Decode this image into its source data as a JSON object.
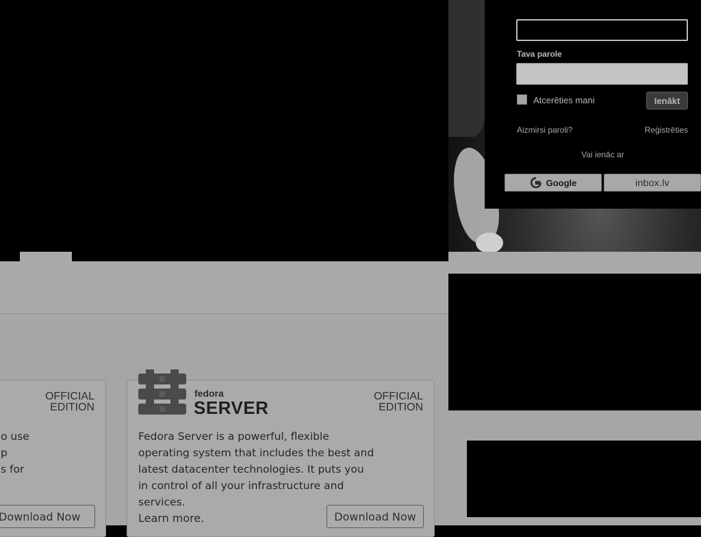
{
  "login": {
    "username_value": "",
    "password_label": "Tava parole",
    "password_value": "",
    "remember_label": "Atcerēties mani",
    "remember_checked": false,
    "submit_label": "Ienākt",
    "forgot_label": "Aizmirsi paroli?",
    "register_label": "Reģistrēties",
    "or_label": "Vai ienāc ar",
    "social": [
      {
        "label": "Google",
        "icon": "google-g-icon"
      },
      {
        "label": "inbox.lv",
        "icon": "inbox-logo"
      }
    ]
  },
  "editions": {
    "left_card": {
      "badge_line1": "OFFICIAL",
      "badge_line2": "EDITION",
      "desc": "o use\np\ns for",
      "download_label": "Download Now"
    },
    "server_card": {
      "brand_small": "fedora",
      "brand_big": "SERVER",
      "badge_line1": "OFFICIAL",
      "badge_line2": "EDITION",
      "desc": "Fedora Server is a powerful, flexible operating system that includes the best and latest datacenter technologies. It puts you in control of all your infrastructure and services.",
      "learn_more": "Learn more.",
      "download_label": "Download Now",
      "icon": "fedora-server-icon"
    }
  },
  "colors": {
    "overlay_gray": "#a9a9a9",
    "panel_black": "#000000",
    "button_dark": "#3a3a3a"
  }
}
